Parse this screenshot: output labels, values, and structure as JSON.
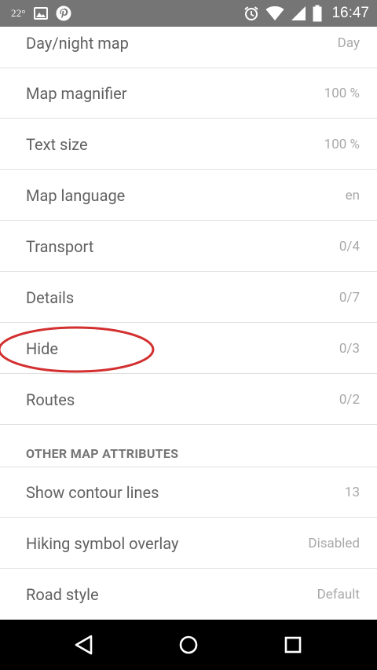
{
  "status_bar": {
    "temperature": "22°",
    "time": "16:47",
    "icons": [
      "image-icon",
      "pinterest-icon",
      "alarm-icon",
      "wifi-icon",
      "signal-icon",
      "battery-icon"
    ]
  },
  "settings": [
    {
      "label": "Day/night map",
      "value": "Day"
    },
    {
      "label": "Map magnifier",
      "value": "100 %"
    },
    {
      "label": "Text size",
      "value": "100 %"
    },
    {
      "label": "Map language",
      "value": "en"
    },
    {
      "label": "Transport",
      "value": "0/4"
    },
    {
      "label": "Details",
      "value": "0/7"
    },
    {
      "label": "Hide",
      "value": "0/3"
    },
    {
      "label": "Routes",
      "value": "0/2"
    }
  ],
  "other_section": {
    "header": "OTHER MAP ATTRIBUTES",
    "items": [
      {
        "label": "Show contour lines",
        "value": "13"
      },
      {
        "label": "Hiking symbol overlay",
        "value": "Disabled"
      },
      {
        "label": "Road style",
        "value": "Default"
      }
    ]
  },
  "annotation": {
    "highlighted_item": "Hide",
    "color": "#d32f2f"
  },
  "colors": {
    "status_bar": "#757575",
    "nav_bar": "#000000",
    "label": "#616161",
    "value": "#a8a8a8",
    "divider": "#e0e0e0"
  },
  "nav_bar": {
    "buttons": [
      "back-icon",
      "home-icon",
      "recents-icon"
    ]
  }
}
